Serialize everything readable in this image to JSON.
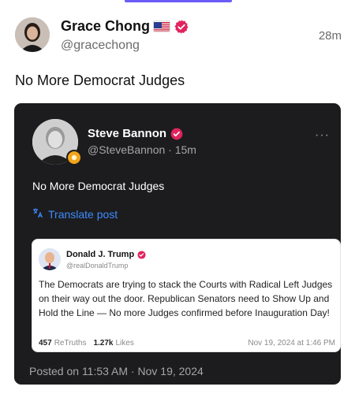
{
  "post": {
    "author_name": "Grace Chong",
    "author_handle": "@gracechong",
    "time": "28m",
    "text": "No More Democrat Judges"
  },
  "embed": {
    "author_name": "Steve Bannon",
    "handle_time": "@SteveBannon · 15m",
    "text": "No More Democrat Judges",
    "translate_label": "Translate post",
    "posted_on": "Posted on 11:53 AM · Nov 19, 2024",
    "quote": {
      "author_name": "Donald J. Trump",
      "author_handle": "@realDonaldTrump",
      "body": "The Democrats are trying to stack the Courts with Radical Left Judges on their way out the door. Republican Senators need to Show Up and Hold the Line — No more Judges confirmed before Inauguration Day!",
      "retruths_count": "457",
      "retruths_label": "ReTruths",
      "likes_count": "1.27k",
      "likes_label": "Likes",
      "date": "Nov 19, 2024 at 1:46 PM"
    }
  },
  "colors": {
    "accent": "#6b5cf6",
    "verified_badge": "#e0245e",
    "link_blue": "#3d8bff",
    "embed_bg": "#1c1c1e"
  },
  "icons": {
    "flag": "us-flag-icon",
    "verified": "verified-badge-icon",
    "more": "more-dots-icon",
    "translate": "translate-icon"
  }
}
